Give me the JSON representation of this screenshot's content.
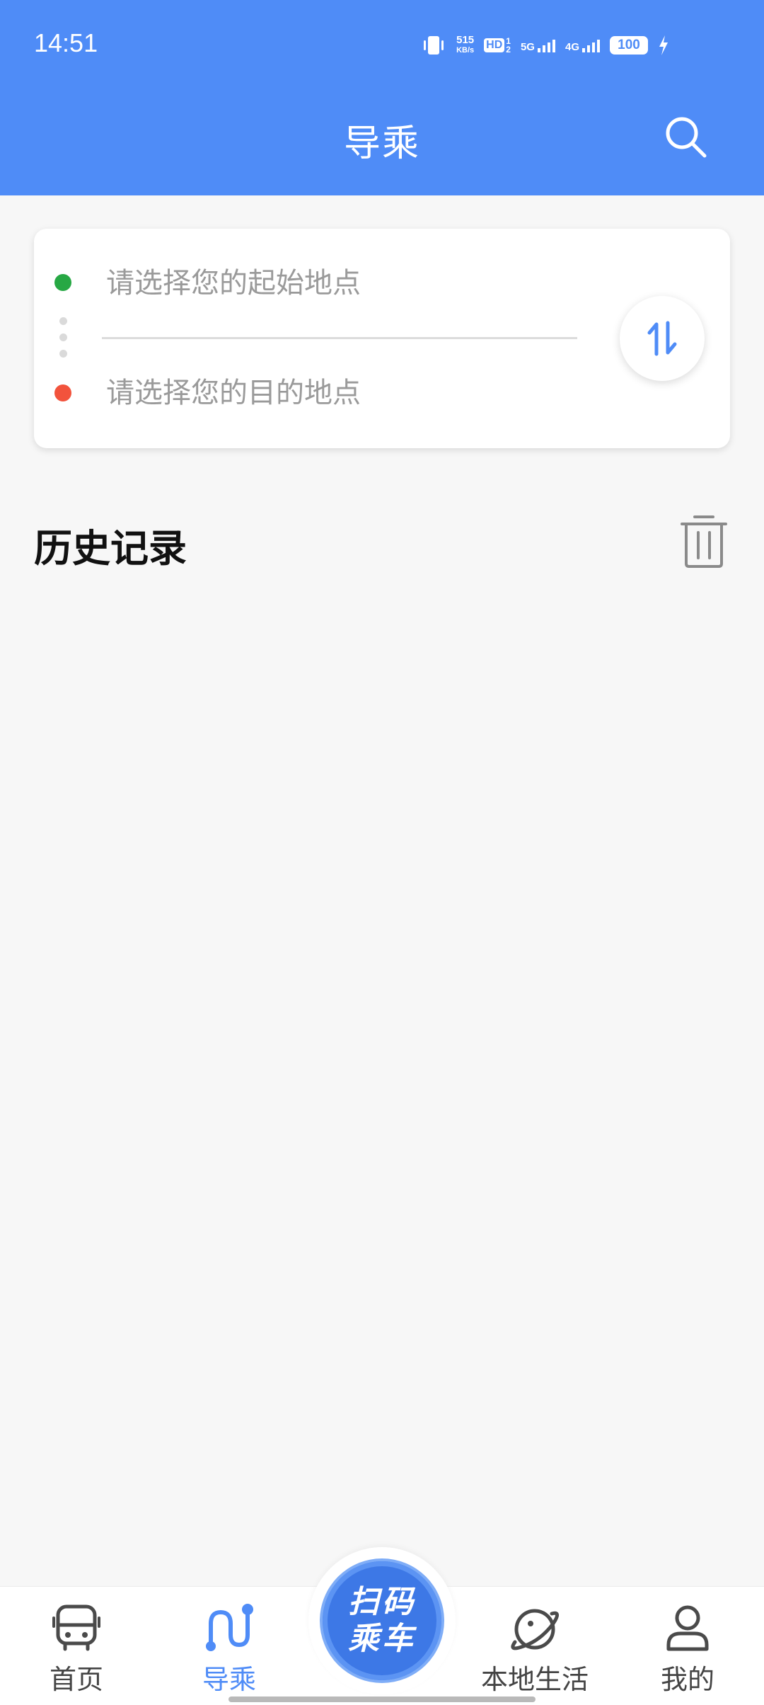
{
  "status_bar": {
    "time": "14:51",
    "net_speed_value": "515",
    "net_speed_unit": "KB/s",
    "hd_label": "HD",
    "network_5g": "5G",
    "network_4g": "4G",
    "battery": "100"
  },
  "header": {
    "title": "导乘",
    "accent_color": "#4f8cf7"
  },
  "route": {
    "start_placeholder": "请选择您的起始地点",
    "end_placeholder": "请选择您的目的地点",
    "start_dot_color": "#27a844",
    "end_dot_color": "#f2533c"
  },
  "history": {
    "title": "历史记录",
    "items": []
  },
  "tabbar": {
    "tabs": [
      {
        "label": "首页",
        "icon": "bus-icon",
        "active": false
      },
      {
        "label": "导乘",
        "icon": "route-icon",
        "active": true
      },
      {
        "label": "本地生活",
        "icon": "planet-icon",
        "active": false
      },
      {
        "label": "我的",
        "icon": "user-icon",
        "active": false
      }
    ],
    "scan": {
      "line1": "扫码",
      "line2": "乘车"
    }
  }
}
